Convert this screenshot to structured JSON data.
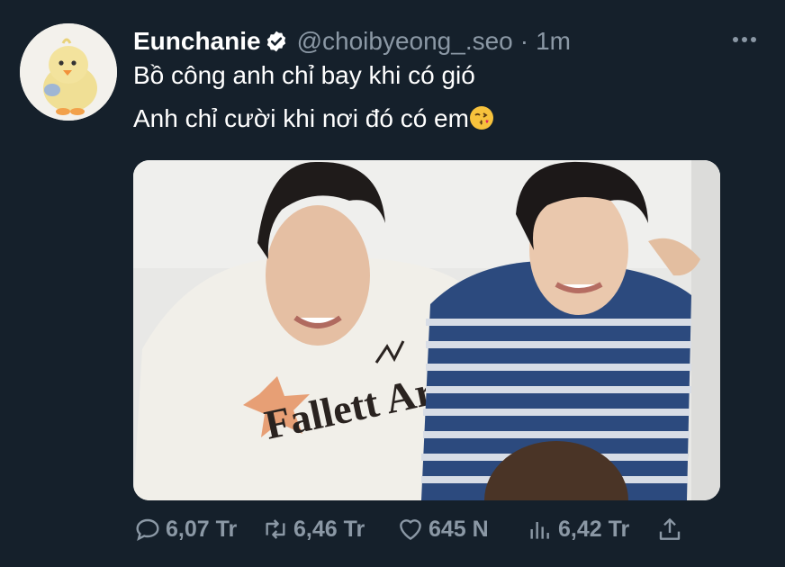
{
  "user": {
    "display_name": "Eunchanie",
    "handle": "@choibyeong_.seo",
    "separator": "·",
    "time": "1m"
  },
  "tweet": {
    "line1": "Bồ công anh chỉ bay khi có gió",
    "line2": "Anh chỉ cười khi nơi đó có em",
    "emoji": "kissing-face-heart-emoji"
  },
  "media": {
    "shirt_text": "Fallett Art"
  },
  "actions": {
    "replies": "6,07 Tr",
    "retweets": "6,46 Tr",
    "likes": "645 N",
    "views": "6,42 Tr"
  },
  "colors": {
    "background": "#15202b",
    "muted": "#8b98a5",
    "text": "#ffffff"
  }
}
